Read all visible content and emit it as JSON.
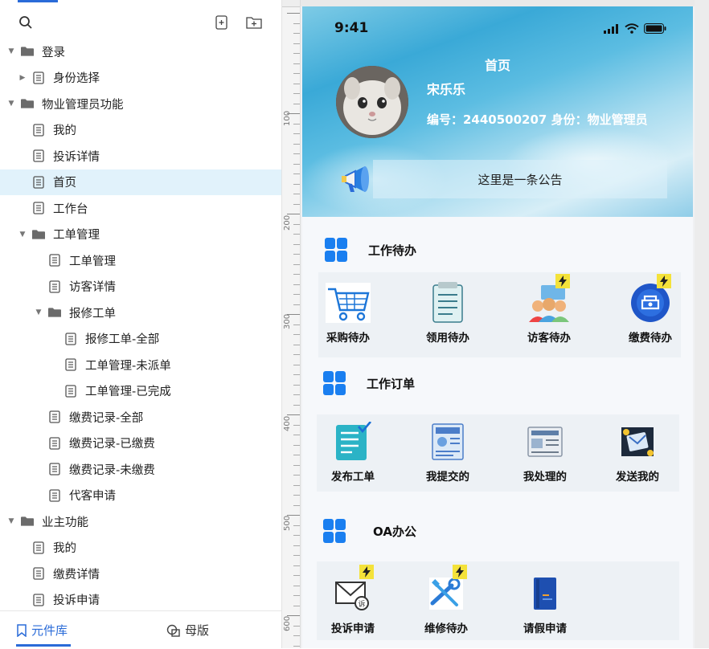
{
  "left_panel": {
    "tree": [
      {
        "label": "登录",
        "level": 0,
        "type": "folder",
        "expanded": true
      },
      {
        "label": "身份选择",
        "level": 1,
        "type": "page",
        "collapsed_arrow": true
      },
      {
        "label": "物业管理员功能",
        "level": 0,
        "type": "folder",
        "expanded": true
      },
      {
        "label": "我的",
        "level": 1,
        "type": "page"
      },
      {
        "label": "投诉详情",
        "level": 1,
        "type": "page"
      },
      {
        "label": "首页",
        "level": 1,
        "type": "page",
        "selected": true
      },
      {
        "label": "工作台",
        "level": 1,
        "type": "page"
      },
      {
        "label": "工单管理",
        "level": 1,
        "type": "folder",
        "expanded": true
      },
      {
        "label": "工单管理",
        "level": 2,
        "type": "page"
      },
      {
        "label": "访客详情",
        "level": 2,
        "type": "page"
      },
      {
        "label": "报修工单",
        "level": 2,
        "type": "folder",
        "expanded": true
      },
      {
        "label": "报修工单-全部",
        "level": 3,
        "type": "page"
      },
      {
        "label": "工单管理-未派单",
        "level": 3,
        "type": "page"
      },
      {
        "label": "工单管理-已完成",
        "level": 3,
        "type": "page"
      },
      {
        "label": "缴费记录-全部",
        "level": 2,
        "type": "page"
      },
      {
        "label": "缴费记录-已缴费",
        "level": 2,
        "type": "page"
      },
      {
        "label": "缴费记录-未缴费",
        "level": 2,
        "type": "page"
      },
      {
        "label": "代客申请",
        "level": 2,
        "type": "page"
      },
      {
        "label": "业主功能",
        "level": 0,
        "type": "folder",
        "expanded": true
      },
      {
        "label": "我的",
        "level": 1,
        "type": "page"
      },
      {
        "label": "缴费详情",
        "level": 1,
        "type": "page"
      },
      {
        "label": "投诉申请",
        "level": 1,
        "type": "page"
      }
    ],
    "tabs": {
      "components": "元件库",
      "masters": "母版"
    }
  },
  "ruler": {
    "labels": [
      "100",
      "200",
      "300",
      "400",
      "500",
      "600"
    ]
  },
  "phone": {
    "status_time": "9:41",
    "title": "首页",
    "user_name": "宋乐乐",
    "user_info": "编号：2440500207    身份：物业管理员",
    "notice": "这里是一条公告",
    "sections": [
      {
        "title": "工作待办",
        "items": [
          "采购待办",
          "领用待办",
          "访客待办",
          "缴费待办"
        ]
      },
      {
        "title": "工作订单",
        "items": [
          "发布工单",
          "我提交的",
          "我处理的",
          "发送我的"
        ]
      },
      {
        "title": "OA办公",
        "items": [
          "投诉申请",
          "维修待办",
          "请假申请"
        ]
      }
    ]
  },
  "colors": {
    "accent": "#2a6bd8",
    "selected_row": "#e1f2fb",
    "grid_icon": "#1a7ff0",
    "card_bg": "#edf1f5",
    "bolt": "#f4e23a"
  }
}
